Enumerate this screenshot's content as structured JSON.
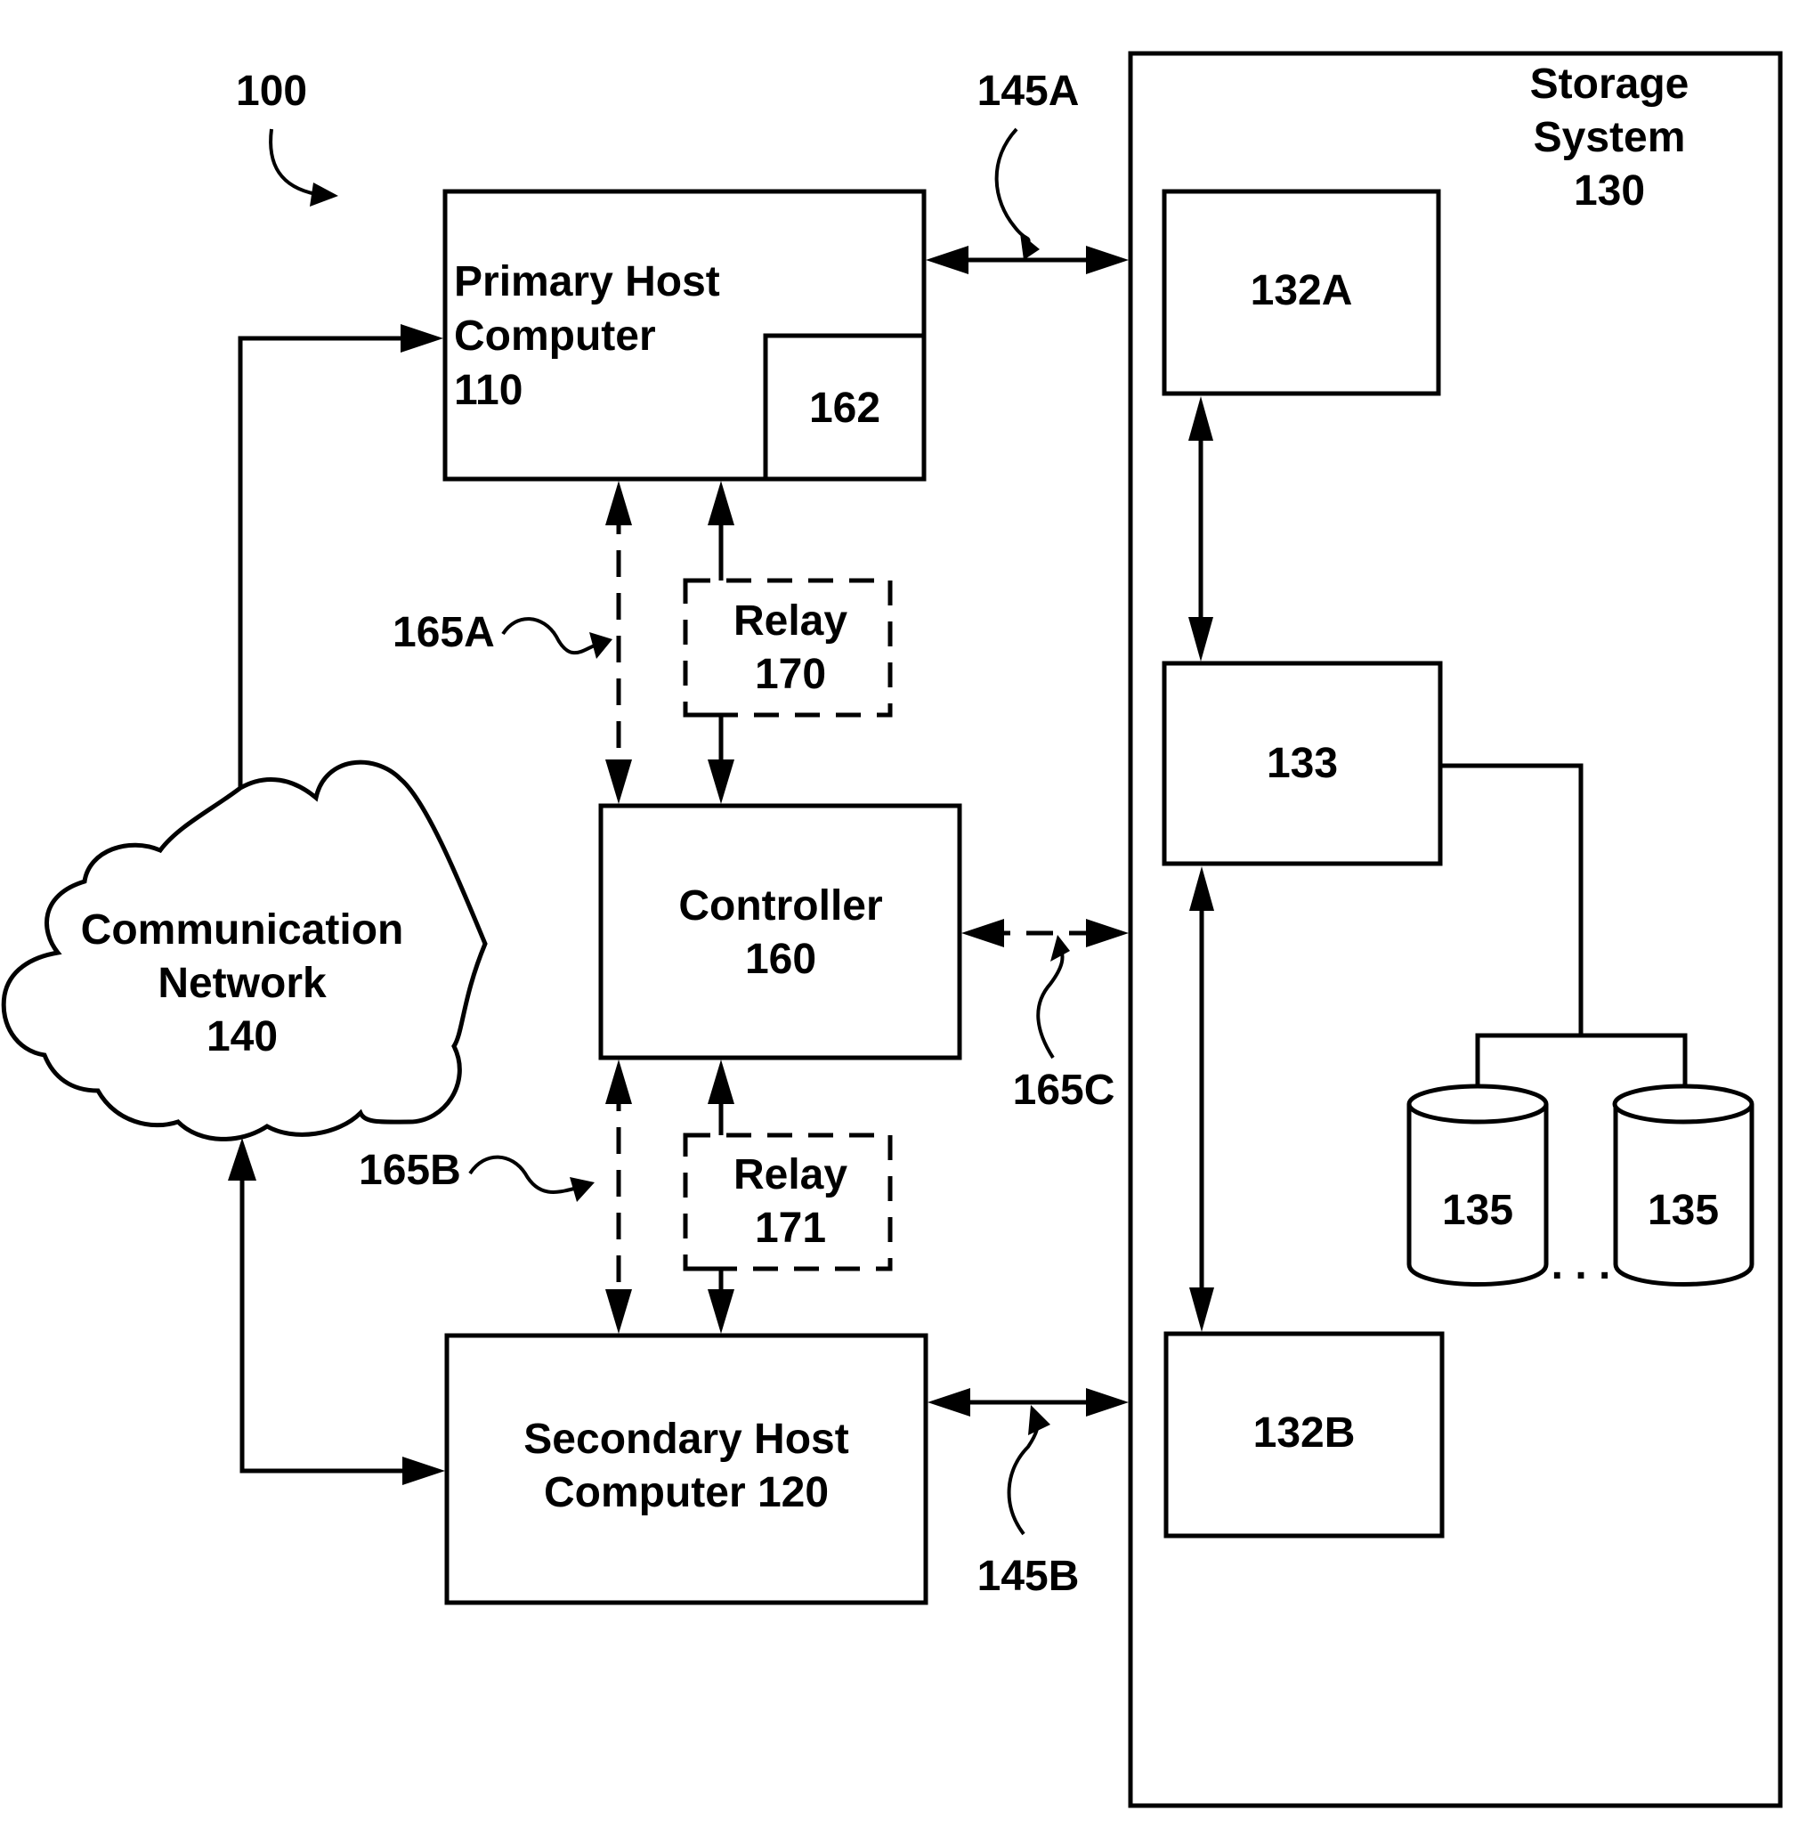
{
  "figure": {
    "ref": "100",
    "colors": {
      "ink": "#000000",
      "background": "#ffffff"
    }
  },
  "primary_host": {
    "line1": "Primary Host",
    "line2": "Computer",
    "line3": "110",
    "sub_module": "162"
  },
  "secondary_host": {
    "line1": "Secondary Host",
    "line2": "Computer 120"
  },
  "controller": {
    "line1": "Controller",
    "line2": "160"
  },
  "relay_170": {
    "line1": "Relay",
    "line2": "170"
  },
  "relay_171": {
    "line1": "Relay",
    "line2": "171"
  },
  "network": {
    "line1": "Communication",
    "line2": "Network",
    "line3": "140"
  },
  "storage": {
    "line1": "Storage",
    "line2": "System",
    "line3": "130",
    "module_a": "132A",
    "module_b": "132B",
    "module_mid": "133",
    "disks": [
      "135",
      "135"
    ],
    "ellipsis": ". . ."
  },
  "links": {
    "l145a": "145A",
    "l145b": "145B",
    "l165a": "165A",
    "l165b": "165B",
    "l165c": "165C"
  }
}
